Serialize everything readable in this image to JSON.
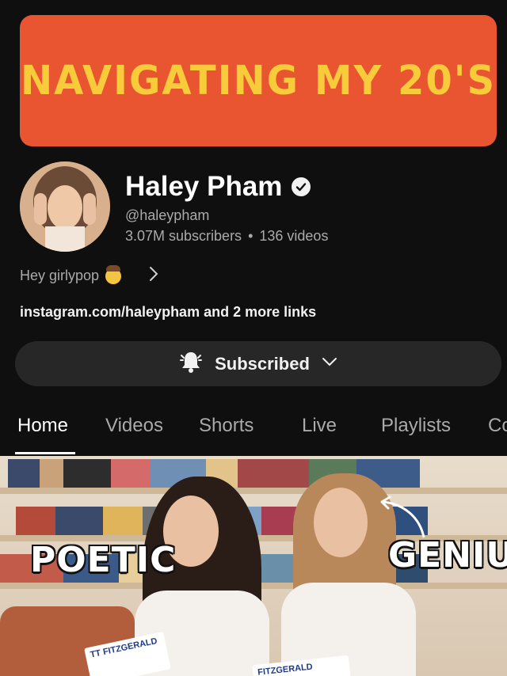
{
  "banner": {
    "text": "NAVIGATING MY 20'S"
  },
  "channel": {
    "name": "Haley Pham",
    "handle": "@haleypham",
    "subscribers": "3.07M subscribers",
    "videos": "136 videos",
    "separator": "•",
    "description": "Hey girlypop",
    "links": "instagram.com/haleypham and 2 more links"
  },
  "subscribe": {
    "label": "Subscribed"
  },
  "tabs": [
    {
      "label": "Home"
    },
    {
      "label": "Videos"
    },
    {
      "label": "Shorts"
    },
    {
      "label": "Live"
    },
    {
      "label": "Playlists"
    },
    {
      "label": "Co"
    }
  ],
  "video": {
    "word_left": "POETIC",
    "word_right": "GENIUS",
    "book_text": "TT FITZGERALD",
    "book_text_right": "FITZGERALD"
  },
  "colors": {
    "banner_bg": "#ea5531",
    "banner_text": "#f8cb3a",
    "background": "#0f0f0f",
    "button_bg": "#272727"
  },
  "icons": {
    "verified": "check-circle-icon",
    "bell": "bell-ringing-icon",
    "chevron_down": "chevron-down-icon",
    "chevron_right": "chevron-right-icon"
  }
}
